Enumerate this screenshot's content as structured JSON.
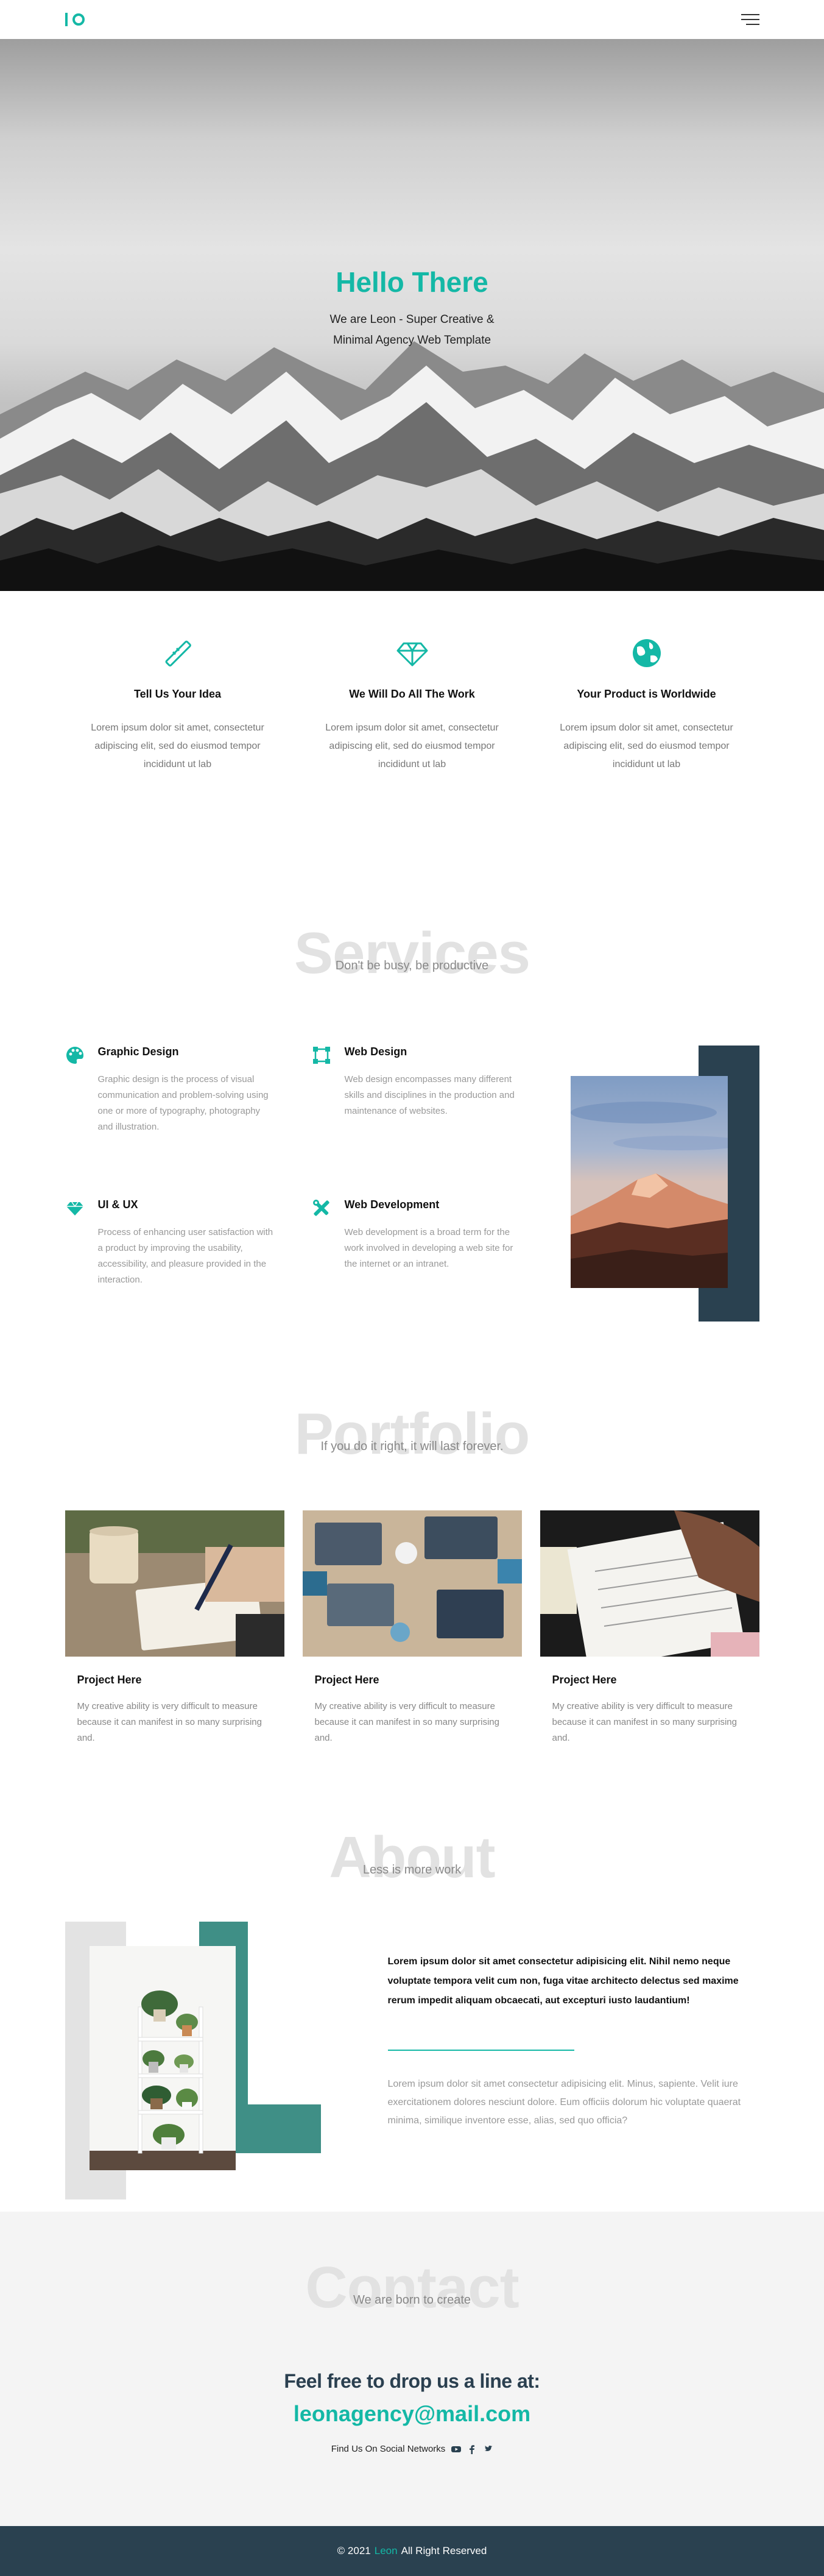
{
  "colors": {
    "accent": "#14b8a6",
    "dark": "#2a4150",
    "muted_teal": "#3f8f86"
  },
  "nav": {
    "menu_icon": "hamburger-menu-icon",
    "logo_icon": "io-logo"
  },
  "hero": {
    "title": "Hello There",
    "subtitle": "We are Leon - Super Creative & Minimal Agency Web Template"
  },
  "features": [
    {
      "icon": "pen-tool-icon",
      "title": "Tell Us Your Idea",
      "text": "Lorem ipsum dolor sit amet, consectetur adipiscing elit, sed do eiusmod tempor incididunt ut lab"
    },
    {
      "icon": "diamond-icon",
      "title": "We Will Do All The Work",
      "text": "Lorem ipsum dolor sit amet, consectetur adipiscing elit, sed do eiusmod tempor incididunt ut lab"
    },
    {
      "icon": "globe-icon",
      "title": "Your Product is Worldwide",
      "text": "Lorem ipsum dolor sit amet, consectetur adipiscing elit, sed do eiusmod tempor incididunt ut lab"
    }
  ],
  "services": {
    "heading": "Services",
    "tagline": "Don't be busy, be productive",
    "items": [
      {
        "icon": "palette-icon",
        "title": "Graphic Design",
        "text": "Graphic design is the process of visual communication and problem-solving using one or more of typography, photography and illustration."
      },
      {
        "icon": "vector-square-icon",
        "title": "Web Design",
        "text": "Web design encompasses many different skills and disciplines in the production and maintenance of websites."
      },
      {
        "icon": "gem-icon",
        "title": "UI & UX",
        "text": "Process of enhancing user satisfaction with a product by improving the usability, accessibility, and pleasure provided in the interaction."
      },
      {
        "icon": "tools-icon",
        "title": "Web Development",
        "text": "Web development is a broad term for the work involved in developing a web site for the internet or an intranet."
      }
    ]
  },
  "portfolio": {
    "heading": "Portfolio",
    "tagline": "If you do it right, it will last forever.",
    "items": [
      {
        "title": "Project Here",
        "text": "My creative ability is very difficult to measure because it can manifest in so many surprising and."
      },
      {
        "title": "Project Here",
        "text": "My creative ability is very difficult to measure because it can manifest in so many surprising and."
      },
      {
        "title": "Project Here",
        "text": "My creative ability is very difficult to measure because it can manifest in so many surprising and."
      }
    ]
  },
  "about": {
    "heading": "About",
    "tagline": "Less is more work",
    "bold": "Lorem ipsum dolor sit amet consectetur adipisicing elit. Nihil nemo neque voluptate tempora velit cum non, fuga vitae architecto delectus sed maxime rerum impedit aliquam obcaecati, aut excepturi iusto laudantium!",
    "para": "Lorem ipsum dolor sit amet consectetur adipisicing elit. Minus, sapiente. Velit iure exercitationem dolores nesciunt dolore. Eum officiis dolorum hic voluptate quaerat minima, similique inventore esse, alias, sed quo officia?"
  },
  "contact": {
    "heading": "Contact",
    "tagline": "We are born to create",
    "line": "Feel free to drop us a line at:",
    "email": "leonagency@mail.com",
    "social_label": "Find Us On Social Networks",
    "social_icons": [
      "youtube-icon",
      "facebook-icon",
      "twitter-icon"
    ]
  },
  "footer": {
    "prefix": "© 2021",
    "brand": "Leon",
    "suffix": "All Right Reserved"
  }
}
